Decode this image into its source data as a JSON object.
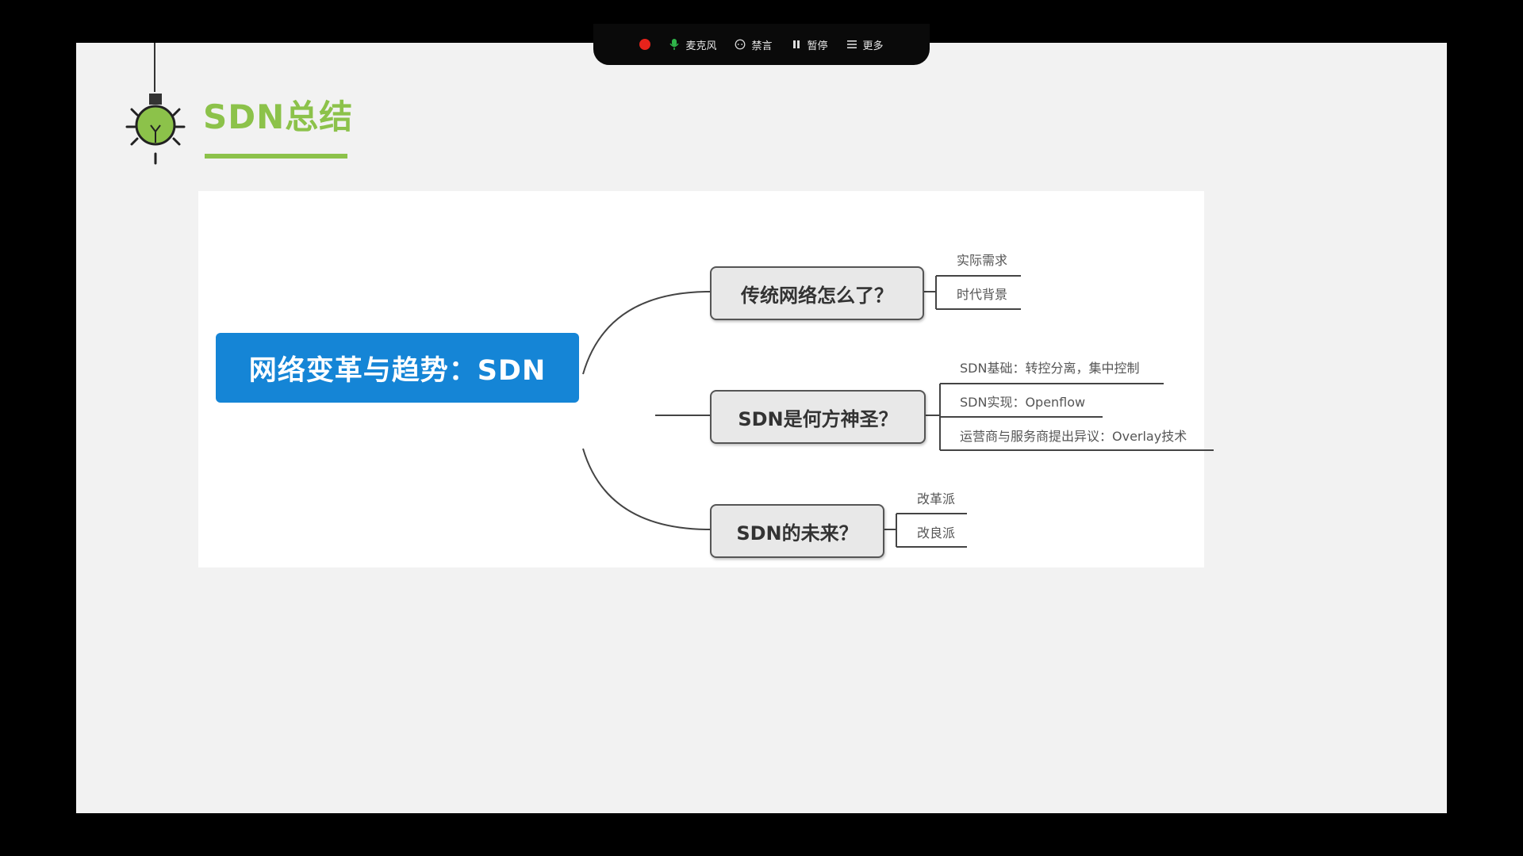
{
  "toolbar": {
    "mic_label": "麦克风",
    "mute_label": "禁言",
    "pause_label": "暂停",
    "more_label": "更多"
  },
  "slide": {
    "title": "SDN总结",
    "accent_color": "#8cc24a"
  },
  "mindmap": {
    "root": "网络变革与趋势：SDN",
    "root_color": "#1585d6",
    "branches": [
      {
        "label": "传统网络怎么了？",
        "leaves": [
          "实际需求",
          "时代背景"
        ]
      },
      {
        "label": "SDN是何方神圣？",
        "leaves": [
          "SDN基础：转控分离，集中控制",
          "SDN实现：Openflow",
          "运营商与服务商提出异议：Overlay技术"
        ]
      },
      {
        "label": "SDN的未来？",
        "leaves": [
          "改革派",
          "改良派"
        ]
      }
    ]
  }
}
